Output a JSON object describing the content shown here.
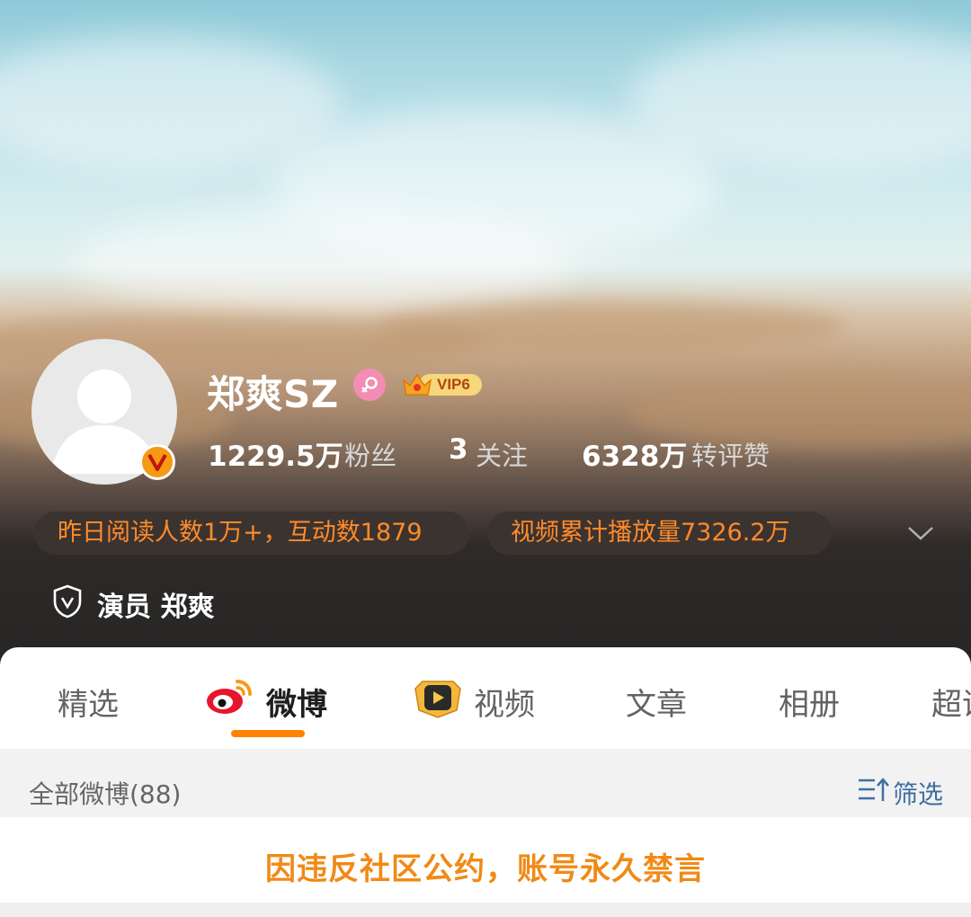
{
  "profile": {
    "name": "郑爽SZ",
    "vip_label": "VIP6",
    "stats": {
      "fans_count": "1229.5万",
      "fans_label": "粉丝",
      "following_count": "3",
      "following_label": "关注",
      "likes_count": "6328万",
      "likes_label": "转评赞"
    },
    "pills": {
      "reading": "昨日阅读人数1万+，互动数1879",
      "video": "视频累计播放量7326.2万"
    },
    "certification": "演员 郑爽"
  },
  "tabs": {
    "featured": "精选",
    "weibo": "微博",
    "video": "视频",
    "articles": "文章",
    "albums": "相册",
    "super_topic": "超话"
  },
  "feed": {
    "all_posts_label": "全部微博(88)",
    "filter_label": "筛选",
    "notice": "因违反社区公约，账号永久禁言"
  },
  "colors": {
    "accent": "#ff8200",
    "pill_text": "#ff8a2a",
    "notice_text": "#f08a16",
    "filter_text": "#3f6fa3"
  }
}
